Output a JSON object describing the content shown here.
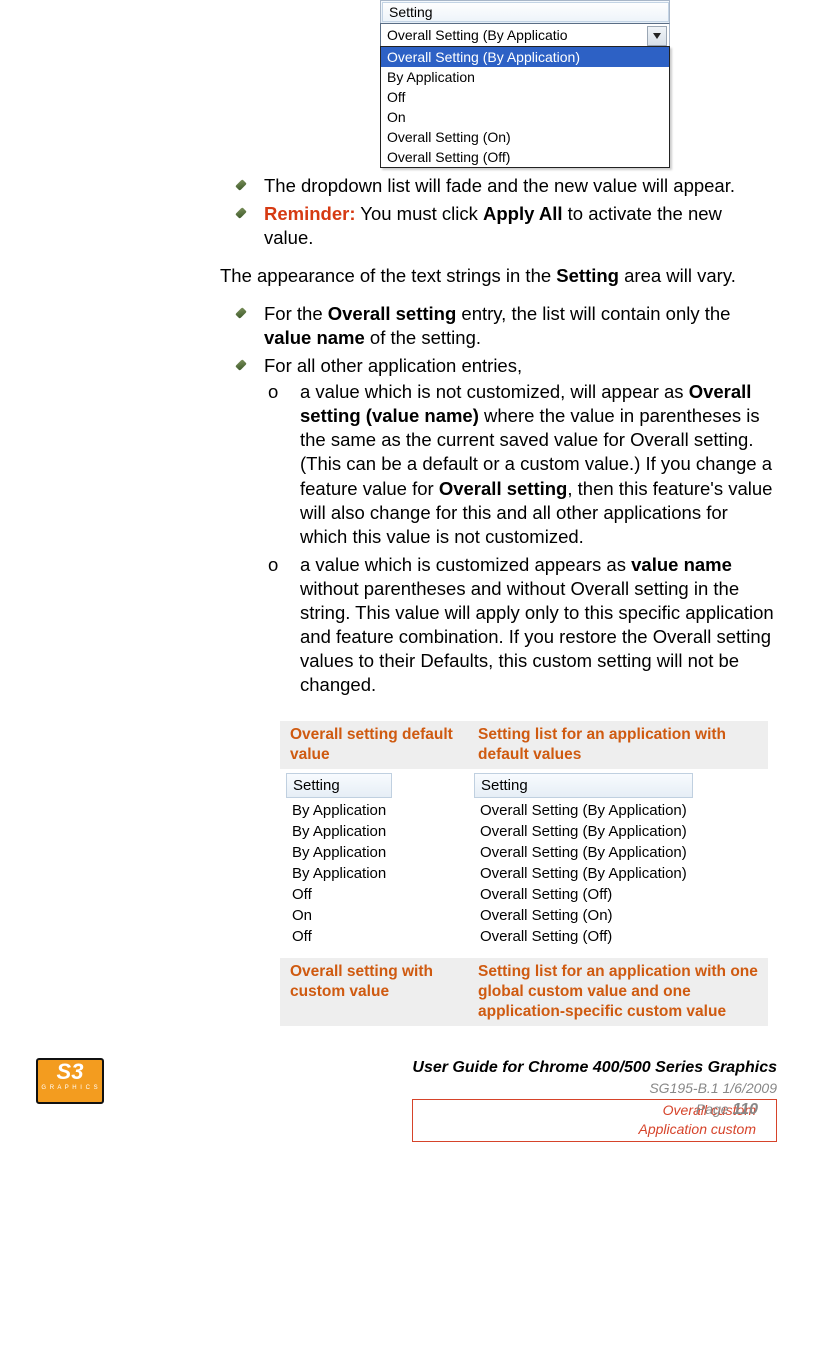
{
  "dropdown": {
    "header": "Setting",
    "selected": "Overall Setting (By Applicatio",
    "options": [
      "Overall Setting (By Application)",
      "By Application",
      "Off",
      "On",
      "Overall Setting (On)",
      "Overall Setting (Off)"
    ]
  },
  "bullet1": "The dropdown list will fade and the new value will appear.",
  "reminder_label": "Reminder:",
  "reminder_text_1": " You must click ",
  "reminder_bold": "Apply All",
  "reminder_text_2": " to activate the new value.",
  "para_intro_1": "The appearance of the text strings in the ",
  "para_intro_bold": "Setting",
  "para_intro_2": " area will vary.",
  "bullet_overall_1": "For the ",
  "bullet_overall_b1": "Overall setting",
  "bullet_overall_2": " entry, the list will contain only the ",
  "bullet_overall_b2": "value name",
  "bullet_overall_3": " of the setting.",
  "bullet_other": "For all other application entries,",
  "o1_1": "a value which is not customized, will appear as ",
  "o1_b1": "Overall setting (value name)",
  "o1_2": " where the value in parentheses is the same as the current saved value for Overall setting. (This can be a default or a custom value.) If you change a feature value for ",
  "o1_b2": "Overall setting",
  "o1_3": ", then this feature's value will also change for this and all other applications for which this value is not customized.",
  "o2_1": "a value which is customized appears as ",
  "o2_b1": "value name",
  "o2_2": " without parentheses and without Overall setting in the string. This value will apply only to this specific application and feature combination. If you restore the Overall setting values to their Defaults, this custom setting will not be changed.",
  "table": {
    "h1": "Overall setting default value",
    "h2": "Setting list for an application with default values",
    "h3": "Overall setting with custom value",
    "h4": "Setting list for an application with one global custom value and one application-specific custom value",
    "list1_header": "Setting",
    "list1": [
      "By Application",
      "By Application",
      "By Application",
      "By Application",
      "Off",
      "On",
      "Off"
    ],
    "list2_header": "Setting",
    "list2": [
      "Overall Setting (By Application)",
      "Overall Setting (By Application)",
      "Overall Setting (By Application)",
      "Overall Setting (By Application)",
      "Overall Setting (Off)",
      "Overall Setting (On)",
      "Overall Setting (Off)"
    ]
  },
  "footer": {
    "title": "User Guide for Chrome 400/500 Series Graphics",
    "meta": "SG195-B.1   1/6/2009",
    "page_label": "Page ",
    "page_num": "110",
    "note1": "Overall custom",
    "note2": "Application custom",
    "logo_main": "S3",
    "logo_sub": "G R A P H I C S"
  }
}
